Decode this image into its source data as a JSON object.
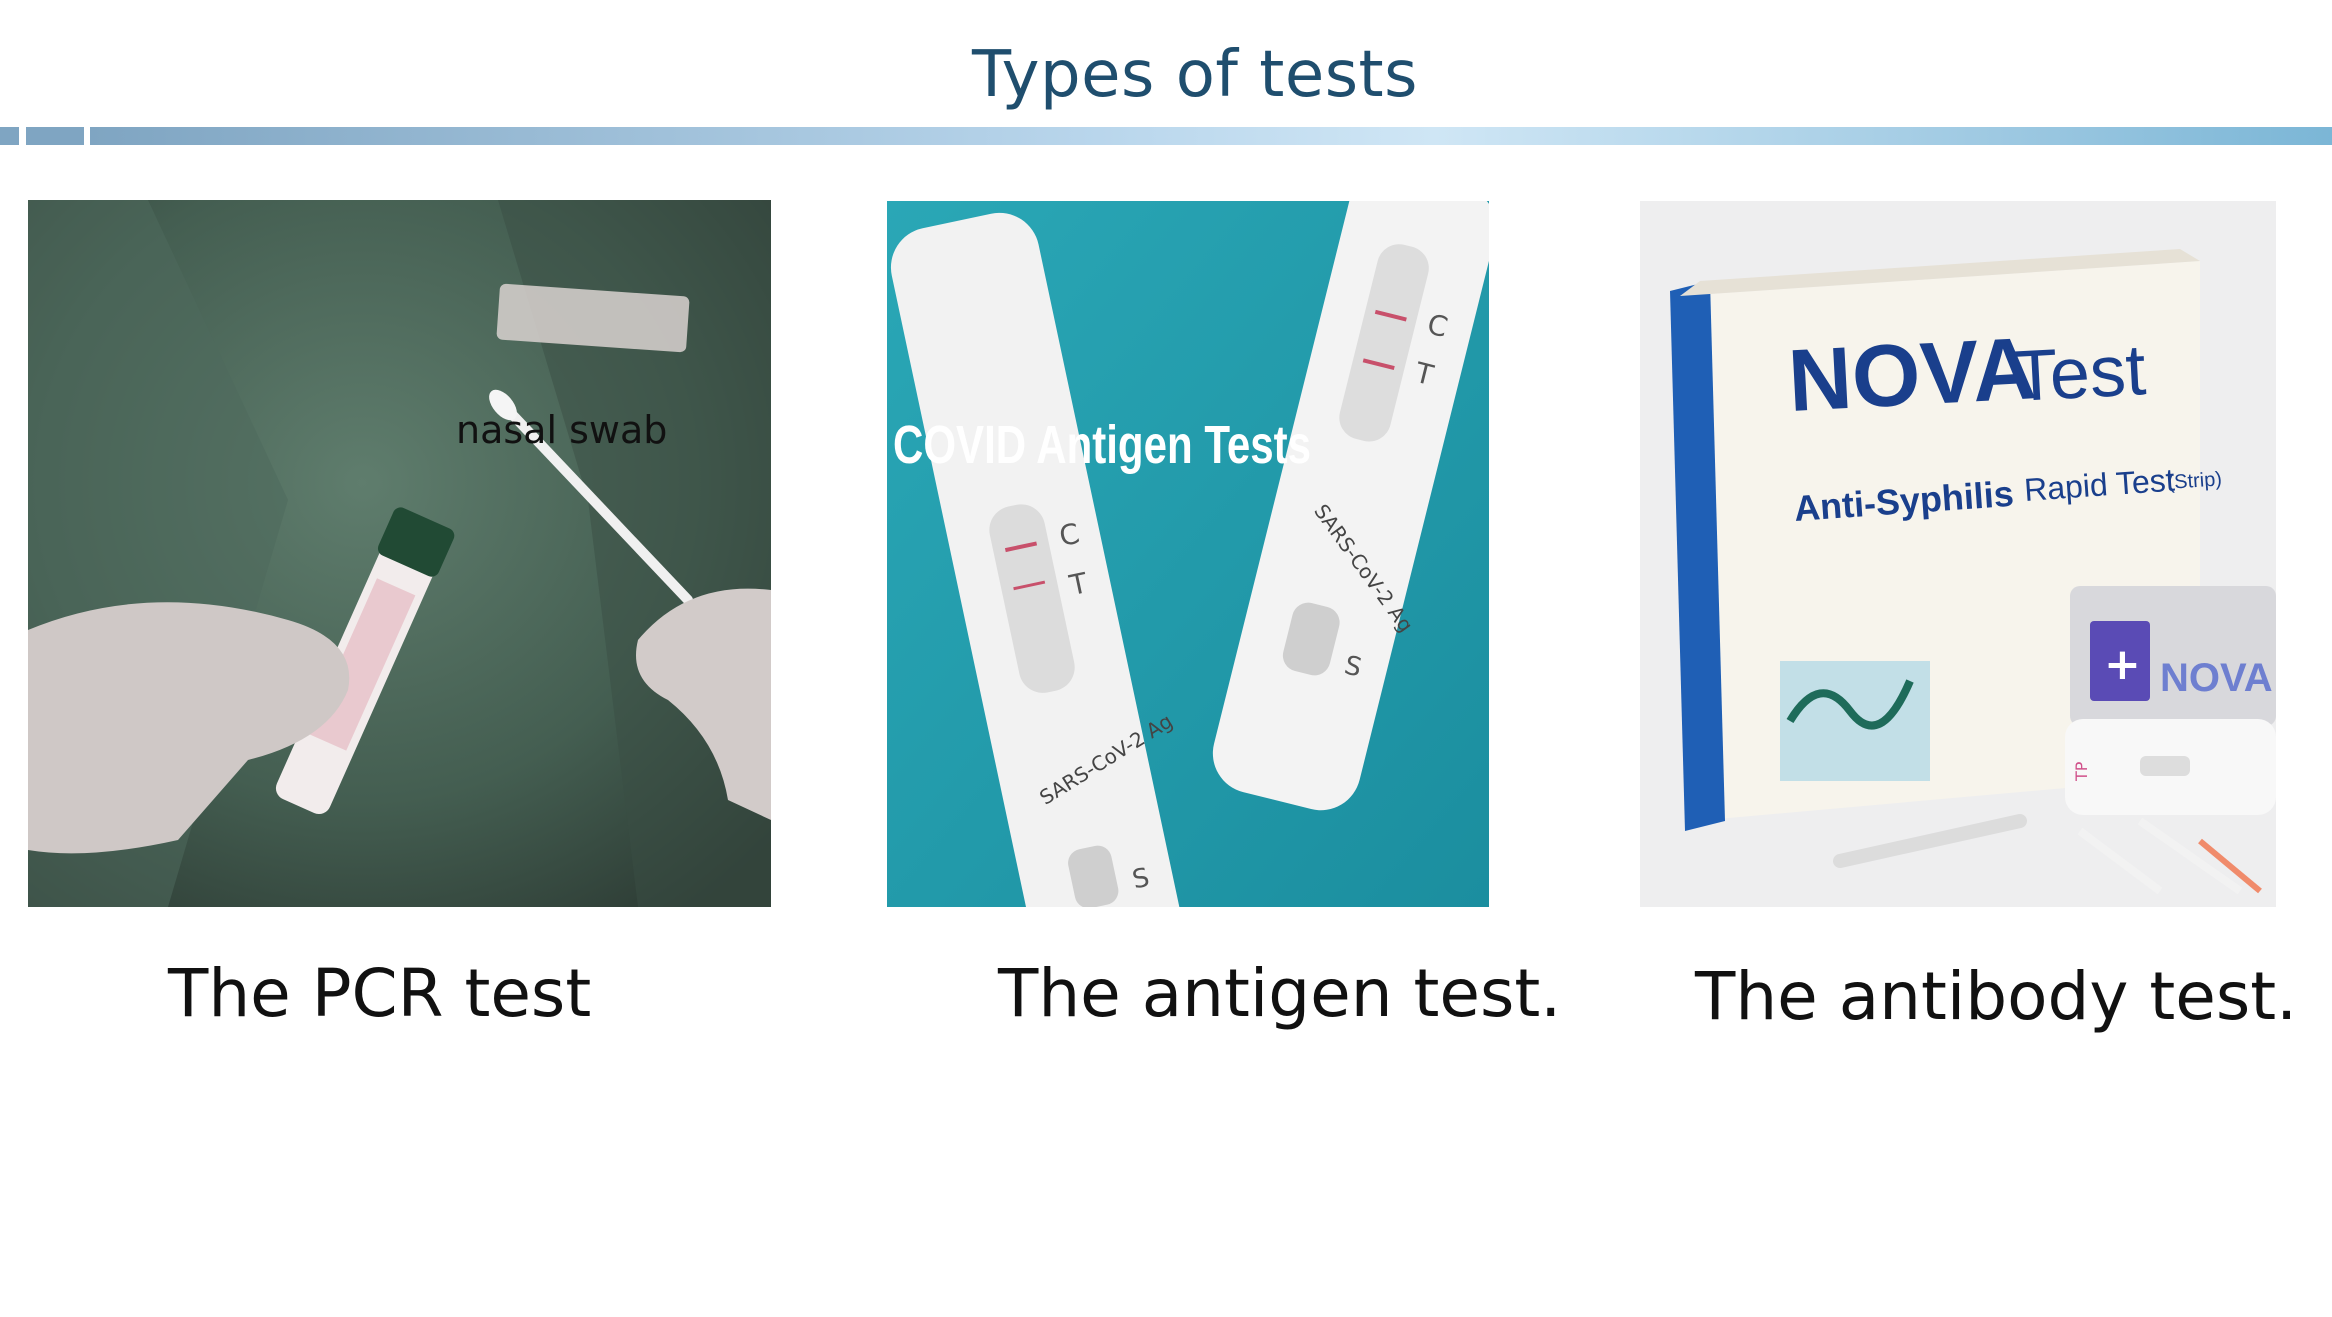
{
  "slide": {
    "title": "Types of tests",
    "colors": {
      "title": "#1f4e6e",
      "rule": "#7fa5c2",
      "rule_light": "#cfe6f5"
    }
  },
  "panels": [
    {
      "caption": "The PCR test",
      "overlay_label": "nasal swab",
      "image_description_icon": "pcr-swab-photo"
    },
    {
      "caption": "The antigen test.",
      "image_headline": "COVID Antigen Tests",
      "device_text": "SARS-CoV-2 Ag",
      "marks": {
        "c": "C",
        "t": "T",
        "s": "S"
      },
      "image_description_icon": "antigen-cassette-photo"
    },
    {
      "caption": "The antibody test.",
      "brand": "NOVA",
      "brand_suffix": "Test",
      "product": "Anti-Syphilis",
      "product_suffix": "Rapid Test",
      "product_note": "(Strip)",
      "strip_label": "TP",
      "image_description_icon": "antibody-kit-photo"
    }
  ]
}
